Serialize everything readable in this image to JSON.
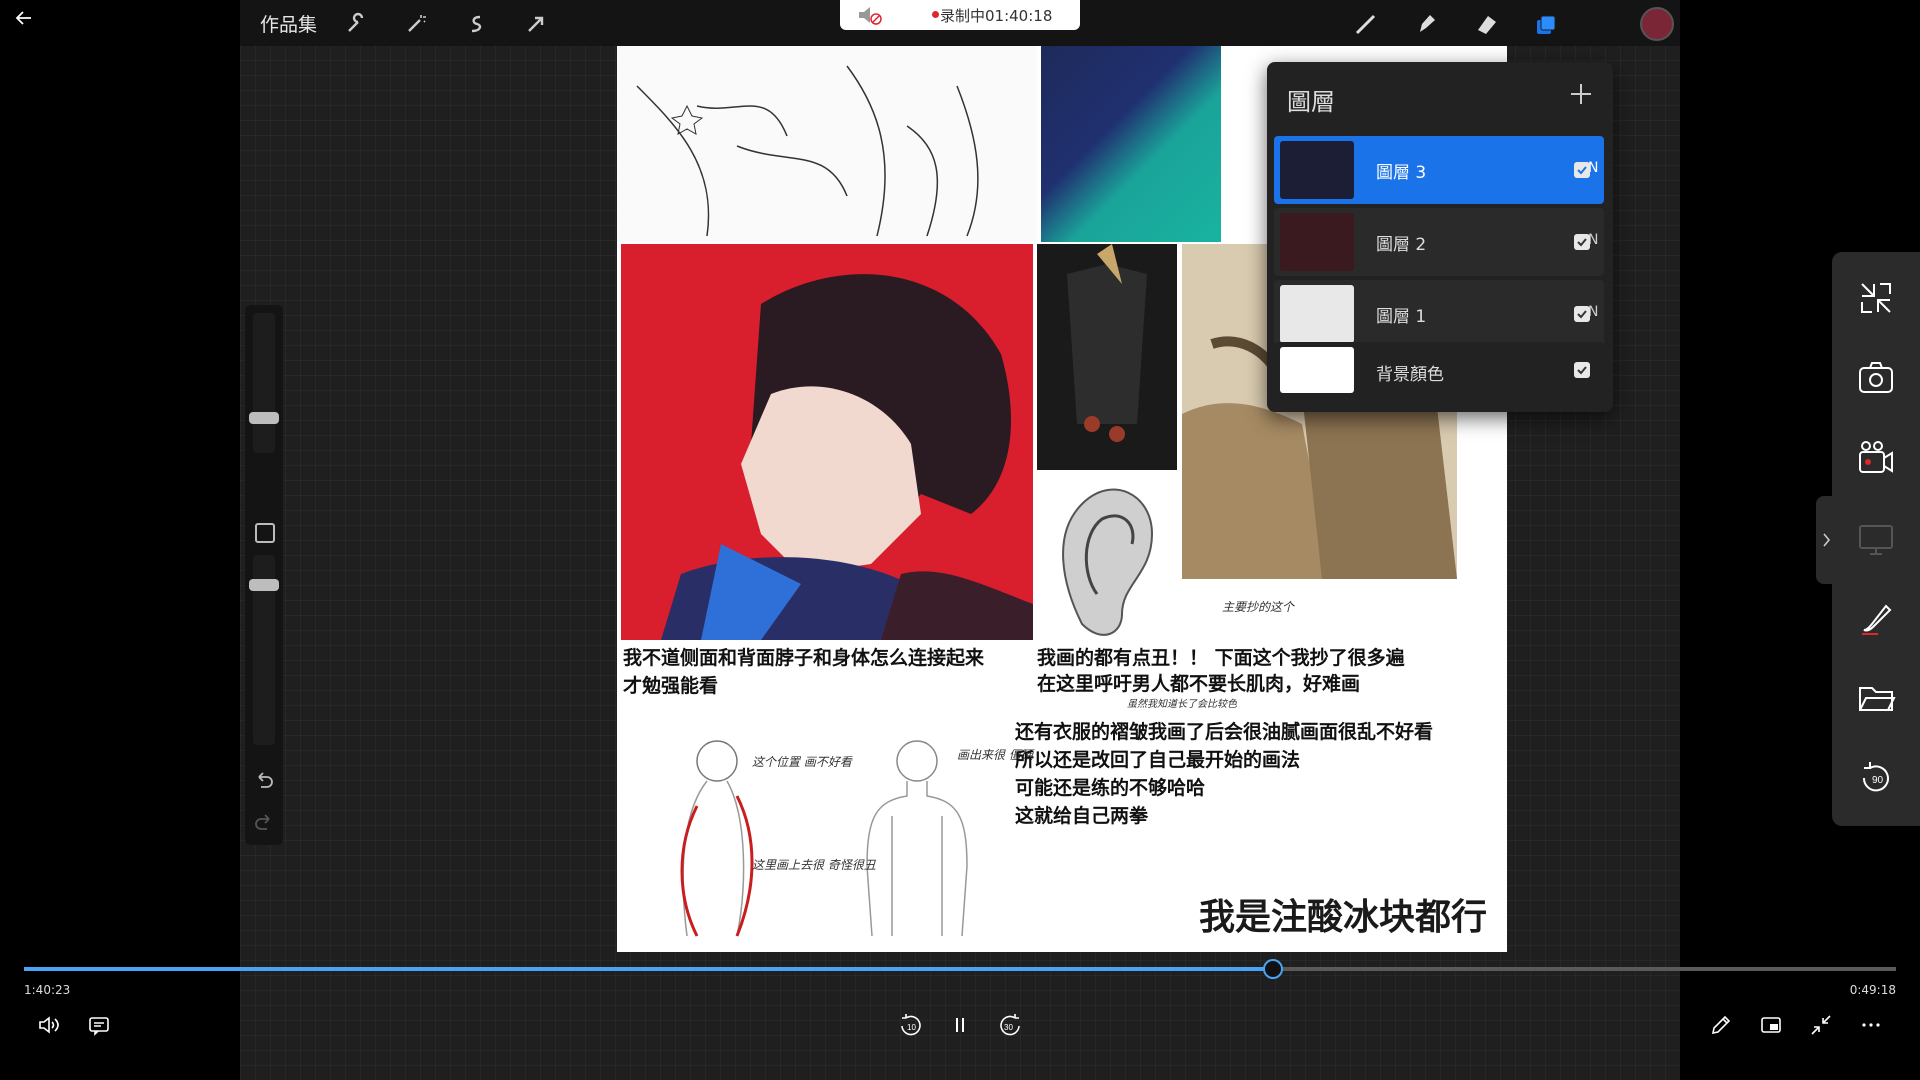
{
  "app": {
    "gallery_label": "作品集",
    "recording": "录制中01:40:18",
    "toolbar_icons": [
      "wrench-icon",
      "magic-wand-icon",
      "selection-icon",
      "transform-icon",
      "brush-icon",
      "smudge-icon",
      "eraser-icon",
      "layers-icon"
    ],
    "brush_color": "#7a2637"
  },
  "layers": {
    "title": "圖層",
    "items": [
      {
        "name": "圖層 3",
        "blend": "N",
        "visible": true,
        "selected": true
      },
      {
        "name": "圖層 2",
        "blend": "N",
        "visible": true,
        "selected": false
      },
      {
        "name": "圖層 1",
        "blend": "N",
        "visible": true,
        "selected": false
      },
      {
        "name": "背景顏色",
        "blend": "",
        "visible": true,
        "selected": false
      }
    ]
  },
  "artwork": {
    "caption_1": "我不道侧面和背面脖子和身体怎么连接起来",
    "caption_1b": "才勉强能看",
    "caption_2": "我画的都有点丑！！ 下面这个我抄了很多遍",
    "caption_2b": "在这里呼吁男人都不要长肌肉，好难画",
    "caption_3": "还有衣服的褶皱我画了后会很油腻画面很乱不好看",
    "caption_3b": "所以还是改回了自己最开始的画法",
    "caption_3c": "可能还是练的不够哈哈",
    "caption_3d": "这就给自己两拳",
    "caption_big": "我是注酸冰块都行",
    "note_1": "这个位置 画不好看",
    "note_2": "画出来很 僵硬",
    "note_3": "主要抄的这个",
    "note_4": "这里画上去很 奇怪很丑",
    "note_5": "虽然我知道长了会比较色"
  },
  "side_panel": {
    "buttons": [
      "exit-fullscreen-icon",
      "screenshot-camera-icon",
      "record-video-icon",
      "screen-cast-icon",
      "annotate-brush-icon",
      "open-folder-icon",
      "rotate-90-icon"
    ]
  },
  "player": {
    "time_elapsed": "1:40:23",
    "time_total": "0:49:18",
    "progress": 0.667,
    "skip_back": "10",
    "skip_forward": "30",
    "accent": "#4aa3f5"
  }
}
